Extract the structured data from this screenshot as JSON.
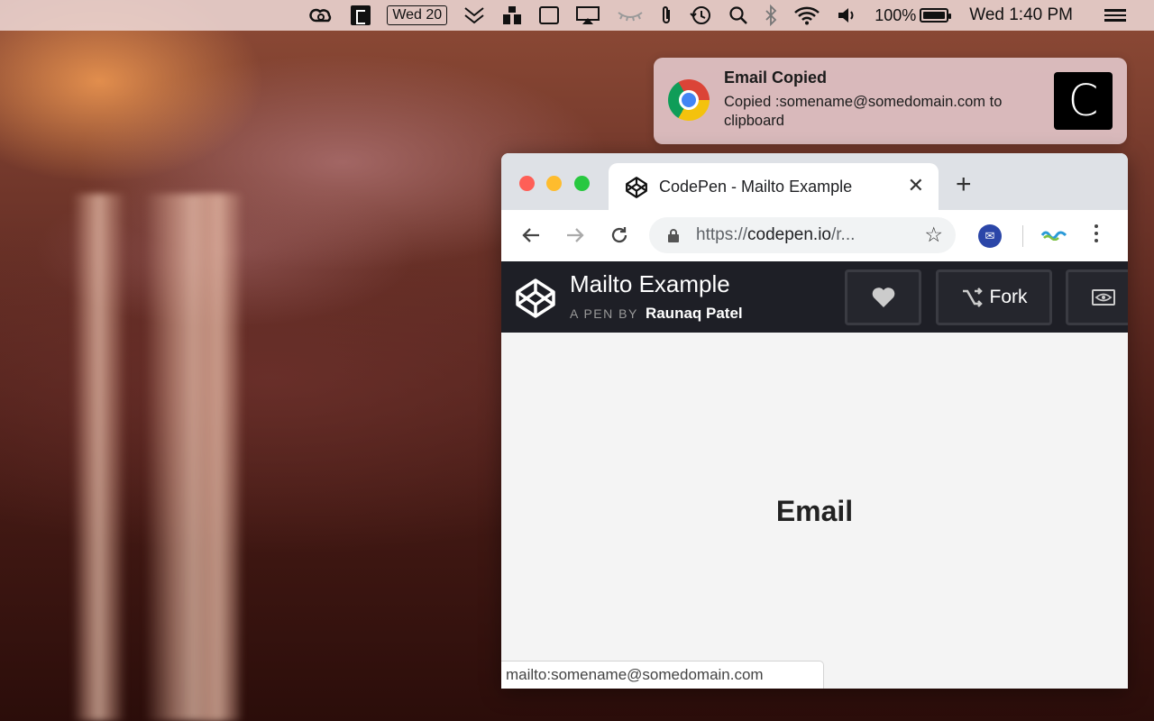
{
  "menubar": {
    "date_badge": "Wed 20",
    "battery": "100%",
    "battery_level": 1.0,
    "clock": "Wed 1:40 PM",
    "icons": [
      "creative-cloud-icon",
      "app-icon",
      "calendar-date-icon",
      "chevron-stack-icon",
      "dropbox-icon",
      "display-icon",
      "airplay-icon",
      "eye-icon",
      "paperclip-icon",
      "time-machine-icon",
      "search-icon",
      "bluetooth-icon",
      "wifi-icon",
      "volume-icon",
      "battery-icon",
      "list-icon"
    ]
  },
  "notification": {
    "title": "Email Copied",
    "body": "Copied :somename@somedomain.com to clipboard",
    "app_letter": "C"
  },
  "browser": {
    "tab_title": "CodePen - Mailto Example",
    "url_scheme": "https://",
    "url_host": "codepen.io",
    "url_rest": "/r...",
    "status_url": "mailto:somename@somedomain.com"
  },
  "codepen": {
    "pen_title": "Mailto Example",
    "byline_prefix": "A PEN BY",
    "author": "Raunaq Patel",
    "fork_label": "Fork",
    "accent": "#1e1f26"
  },
  "page": {
    "heading": "Email"
  }
}
